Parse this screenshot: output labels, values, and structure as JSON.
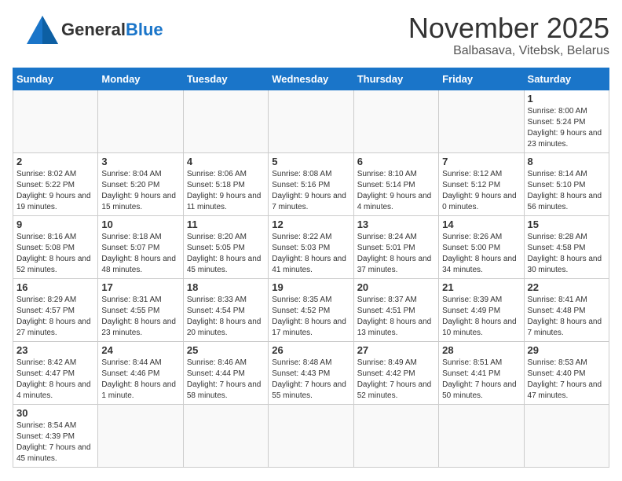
{
  "header": {
    "logo_general": "General",
    "logo_blue": "Blue",
    "title": "November 2025",
    "subtitle": "Balbasava, Vitebsk, Belarus"
  },
  "calendar": {
    "days_of_week": [
      "Sunday",
      "Monday",
      "Tuesday",
      "Wednesday",
      "Thursday",
      "Friday",
      "Saturday"
    ],
    "weeks": [
      [
        {
          "day": "",
          "info": ""
        },
        {
          "day": "",
          "info": ""
        },
        {
          "day": "",
          "info": ""
        },
        {
          "day": "",
          "info": ""
        },
        {
          "day": "",
          "info": ""
        },
        {
          "day": "",
          "info": ""
        },
        {
          "day": "1",
          "info": "Sunrise: 8:00 AM\nSunset: 5:24 PM\nDaylight: 9 hours and 23 minutes."
        }
      ],
      [
        {
          "day": "2",
          "info": "Sunrise: 8:02 AM\nSunset: 5:22 PM\nDaylight: 9 hours and 19 minutes."
        },
        {
          "day": "3",
          "info": "Sunrise: 8:04 AM\nSunset: 5:20 PM\nDaylight: 9 hours and 15 minutes."
        },
        {
          "day": "4",
          "info": "Sunrise: 8:06 AM\nSunset: 5:18 PM\nDaylight: 9 hours and 11 minutes."
        },
        {
          "day": "5",
          "info": "Sunrise: 8:08 AM\nSunset: 5:16 PM\nDaylight: 9 hours and 7 minutes."
        },
        {
          "day": "6",
          "info": "Sunrise: 8:10 AM\nSunset: 5:14 PM\nDaylight: 9 hours and 4 minutes."
        },
        {
          "day": "7",
          "info": "Sunrise: 8:12 AM\nSunset: 5:12 PM\nDaylight: 9 hours and 0 minutes."
        },
        {
          "day": "8",
          "info": "Sunrise: 8:14 AM\nSunset: 5:10 PM\nDaylight: 8 hours and 56 minutes."
        }
      ],
      [
        {
          "day": "9",
          "info": "Sunrise: 8:16 AM\nSunset: 5:08 PM\nDaylight: 8 hours and 52 minutes."
        },
        {
          "day": "10",
          "info": "Sunrise: 8:18 AM\nSunset: 5:07 PM\nDaylight: 8 hours and 48 minutes."
        },
        {
          "day": "11",
          "info": "Sunrise: 8:20 AM\nSunset: 5:05 PM\nDaylight: 8 hours and 45 minutes."
        },
        {
          "day": "12",
          "info": "Sunrise: 8:22 AM\nSunset: 5:03 PM\nDaylight: 8 hours and 41 minutes."
        },
        {
          "day": "13",
          "info": "Sunrise: 8:24 AM\nSunset: 5:01 PM\nDaylight: 8 hours and 37 minutes."
        },
        {
          "day": "14",
          "info": "Sunrise: 8:26 AM\nSunset: 5:00 PM\nDaylight: 8 hours and 34 minutes."
        },
        {
          "day": "15",
          "info": "Sunrise: 8:28 AM\nSunset: 4:58 PM\nDaylight: 8 hours and 30 minutes."
        }
      ],
      [
        {
          "day": "16",
          "info": "Sunrise: 8:29 AM\nSunset: 4:57 PM\nDaylight: 8 hours and 27 minutes."
        },
        {
          "day": "17",
          "info": "Sunrise: 8:31 AM\nSunset: 4:55 PM\nDaylight: 8 hours and 23 minutes."
        },
        {
          "day": "18",
          "info": "Sunrise: 8:33 AM\nSunset: 4:54 PM\nDaylight: 8 hours and 20 minutes."
        },
        {
          "day": "19",
          "info": "Sunrise: 8:35 AM\nSunset: 4:52 PM\nDaylight: 8 hours and 17 minutes."
        },
        {
          "day": "20",
          "info": "Sunrise: 8:37 AM\nSunset: 4:51 PM\nDaylight: 8 hours and 13 minutes."
        },
        {
          "day": "21",
          "info": "Sunrise: 8:39 AM\nSunset: 4:49 PM\nDaylight: 8 hours and 10 minutes."
        },
        {
          "day": "22",
          "info": "Sunrise: 8:41 AM\nSunset: 4:48 PM\nDaylight: 8 hours and 7 minutes."
        }
      ],
      [
        {
          "day": "23",
          "info": "Sunrise: 8:42 AM\nSunset: 4:47 PM\nDaylight: 8 hours and 4 minutes."
        },
        {
          "day": "24",
          "info": "Sunrise: 8:44 AM\nSunset: 4:46 PM\nDaylight: 8 hours and 1 minute."
        },
        {
          "day": "25",
          "info": "Sunrise: 8:46 AM\nSunset: 4:44 PM\nDaylight: 7 hours and 58 minutes."
        },
        {
          "day": "26",
          "info": "Sunrise: 8:48 AM\nSunset: 4:43 PM\nDaylight: 7 hours and 55 minutes."
        },
        {
          "day": "27",
          "info": "Sunrise: 8:49 AM\nSunset: 4:42 PM\nDaylight: 7 hours and 52 minutes."
        },
        {
          "day": "28",
          "info": "Sunrise: 8:51 AM\nSunset: 4:41 PM\nDaylight: 7 hours and 50 minutes."
        },
        {
          "day": "29",
          "info": "Sunrise: 8:53 AM\nSunset: 4:40 PM\nDaylight: 7 hours and 47 minutes."
        }
      ],
      [
        {
          "day": "30",
          "info": "Sunrise: 8:54 AM\nSunset: 4:39 PM\nDaylight: 7 hours and 45 minutes."
        },
        {
          "day": "",
          "info": ""
        },
        {
          "day": "",
          "info": ""
        },
        {
          "day": "",
          "info": ""
        },
        {
          "day": "",
          "info": ""
        },
        {
          "day": "",
          "info": ""
        },
        {
          "day": "",
          "info": ""
        }
      ]
    ]
  }
}
